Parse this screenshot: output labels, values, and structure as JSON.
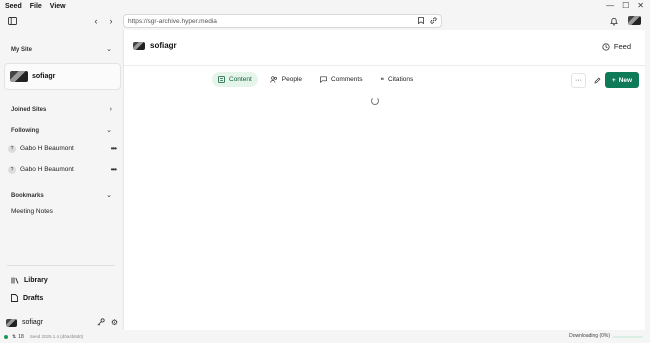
{
  "menubar": {
    "items": [
      "Seed",
      "File",
      "View"
    ]
  },
  "toolbar": {
    "url": "https://sgr-archive.hyper.media"
  },
  "sidebar": {
    "my_site_label": "My Site",
    "site_name": "sofiagr",
    "joined_sites_label": "Joined Sites",
    "following_label": "Following",
    "following": [
      {
        "name": "Gabo H Beaumont"
      },
      {
        "name": "Gabo H Beaumont"
      }
    ],
    "bookmarks_label": "Bookmarks",
    "bookmarks": [
      {
        "label": "Meeting Notes"
      }
    ],
    "library_label": "Library",
    "drafts_label": "Drafts",
    "user_name": "sofiagr"
  },
  "main": {
    "site_title": "sofiagr",
    "feed_label": "Feed",
    "tabs": [
      {
        "label": "Content",
        "active": true
      },
      {
        "label": "People",
        "active": false
      },
      {
        "label": "Comments",
        "active": false
      },
      {
        "label": "Citations",
        "active": false
      }
    ],
    "more_label": "···",
    "new_label": "New"
  },
  "statusbar": {
    "peers": "18",
    "version": "Seed 2025.1.4 (d0a4b8d0)",
    "download": "Downloading (0%)",
    "download_progress": 0
  },
  "colors": {
    "accent": "#0f7a57",
    "active_tab_bg": "#e6f5ea"
  }
}
